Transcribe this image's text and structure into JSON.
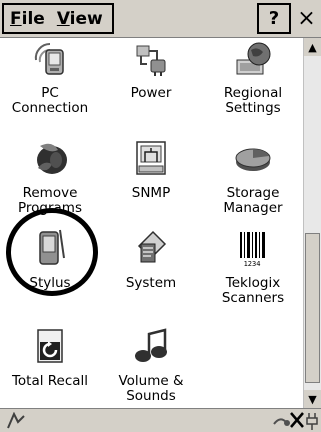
{
  "menubar": {
    "file_label": "File",
    "view_label": "View",
    "help_label": "?",
    "close_label": "×"
  },
  "items": [
    {
      "label_l1": "PC",
      "label_l2": "Connection",
      "icon": "pc-connection-icon"
    },
    {
      "label_l1": "Power",
      "label_l2": "",
      "icon": "power-icon"
    },
    {
      "label_l1": "Regional",
      "label_l2": "Settings",
      "icon": "regional-settings-icon"
    },
    {
      "label_l1": "Remove",
      "label_l2": "Programs",
      "icon": "remove-programs-icon"
    },
    {
      "label_l1": "SNMP",
      "label_l2": "",
      "icon": "snmp-icon"
    },
    {
      "label_l1": "Storage",
      "label_l2": "Manager",
      "icon": "storage-manager-icon"
    },
    {
      "label_l1": "Stylus",
      "label_l2": "",
      "icon": "stylus-icon"
    },
    {
      "label_l1": "System",
      "label_l2": "",
      "icon": "system-icon"
    },
    {
      "label_l1": "Teklogix",
      "label_l2": "Scanners",
      "icon": "teklogix-scanners-icon"
    },
    {
      "label_l1": "Total Recall",
      "label_l2": "",
      "icon": "total-recall-icon"
    },
    {
      "label_l1": "Volume &",
      "label_l2": "Sounds",
      "icon": "volume-sounds-icon"
    }
  ],
  "scrollbar": {
    "up_arrow": "▲",
    "down_arrow": "▼"
  }
}
